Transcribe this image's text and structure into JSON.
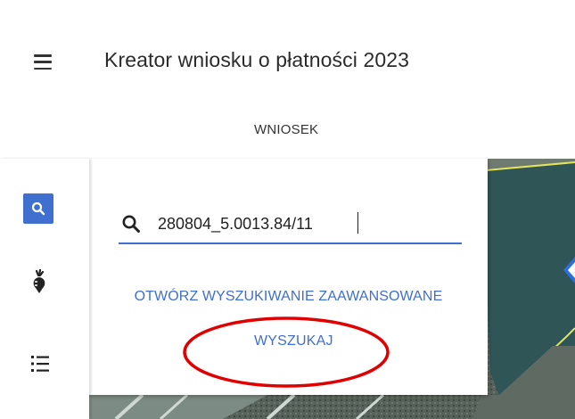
{
  "header": {
    "title": "Kreator wniosku o płatności 2023",
    "tab_label": "WNIOSEK"
  },
  "search": {
    "value": "280804_5.0013.84/11",
    "advanced_link": "OTWÓRZ WYSZUKIWANIE ZAAWANSOWANE",
    "submit_label": "WYSZUKAJ"
  },
  "sidebar": {
    "items": [
      {
        "icon": "search-icon",
        "active": true
      },
      {
        "icon": "crop-icon",
        "active": false
      },
      {
        "icon": "list-icon",
        "active": false
      }
    ]
  },
  "colors": {
    "accent": "#3f6fcf",
    "annotation": "#e00000",
    "parcel_border": "#e5e55a"
  }
}
